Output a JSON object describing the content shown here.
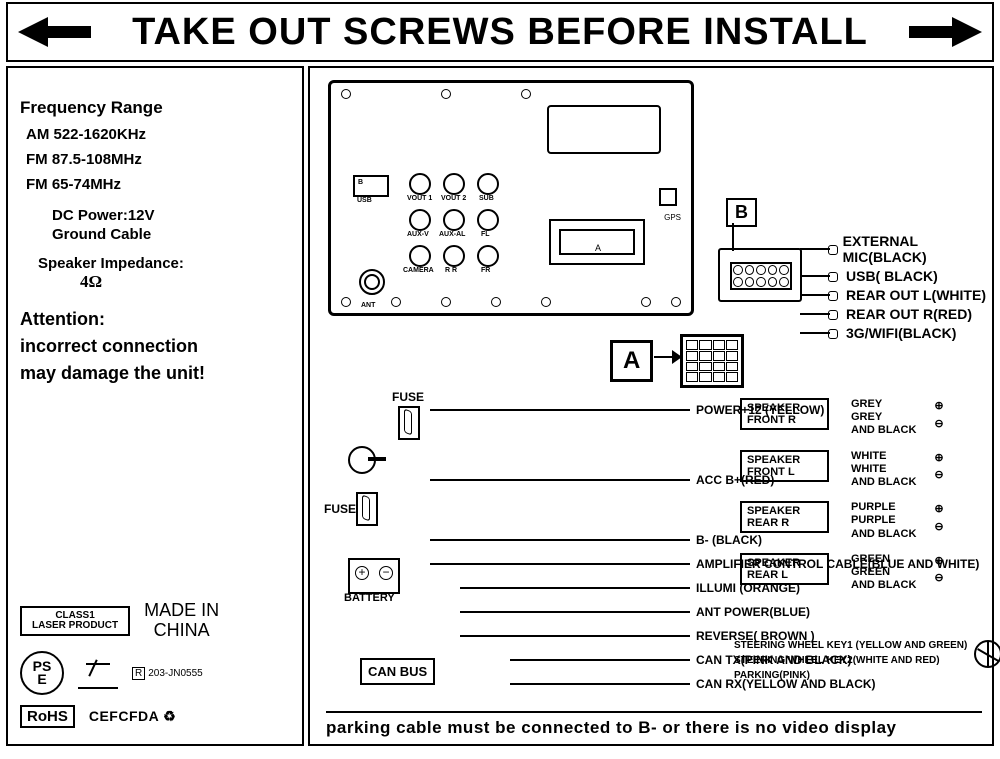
{
  "header": "TAKE OUT SCREWS BEFORE INSTALL",
  "left": {
    "freq_title": "Frequency Range",
    "am": "AM 522-1620KHz",
    "fm1": "FM 87.5-108MHz",
    "fm2": "FM 65-74MHz",
    "dc": "DC Power:12V",
    "ground": "Ground Cable",
    "speaker_imp": "Speaker Impedance:",
    "ohm": "4Ω",
    "attention": "Attention:\nincorrect connection\nmay damage the unit!",
    "class1_l1": "CLASS1",
    "class1_l2": "LASER PRODUCT",
    "madein_l1": "MADE IN",
    "madein_l2": "CHINA",
    "pse": "PS\nE",
    "reg": "203-JN0555",
    "rohs": "RoHS",
    "certs": "CEFCFDA ♻"
  },
  "chassis": {
    "usb": "USB",
    "b": "B",
    "vout1": "VOUT 1",
    "vout2": "VOUT 2",
    "sub": "SUB",
    "auxv": "AUX-V",
    "auxal": "AUX-AL",
    "fl": "FL",
    "camera": "CAMERA",
    "rr": "R R",
    "fr": "FR",
    "ant": "ANT",
    "gps": "GPS",
    "a": "A"
  },
  "b_label": "B",
  "b_wires": {
    "ext_mic": "EXTERNAL MIC(BLACK)",
    "usb": "USB( BLACK)",
    "rear_l": "REAR OUT L(WHITE)",
    "rear_r": "REAR OUT R(RED)",
    "wifi": "3G/WIFI(BLACK)"
  },
  "a_label": "A",
  "fuse": "FUSE",
  "battery": "BATTERY",
  "canbus": "CAN BUS",
  "wires": {
    "power12": "POWER+12 (YELLOW)",
    "acc": "ACC B+(RED)",
    "bminus": "B- (BLACK)",
    "amp": "AMPLIFIER CONTROL CABLE(BLUE AND WHITE)",
    "illumi": "ILLUMI (ORANGE)",
    "antpower": "ANT POWER(BLUE)",
    "reverse": "REVERSE( BROWN )",
    "cantx": "CAN TX(PINK AND BLACK)",
    "canrx": "CAN RX(YELLOW AND BLACK)"
  },
  "speakers": [
    {
      "label": "SPEAKER\nFRONT   R",
      "c1": "GREY",
      "c2": "GREY\nAND BLACK"
    },
    {
      "label": "SPEAKER\nFRONT   L",
      "c1": "WHITE",
      "c2": "WHITE\nAND BLACK"
    },
    {
      "label": "SPEAKER\nREAR    R",
      "c1": "PURPLE",
      "c2": "PURPLE\nAND BLACK"
    },
    {
      "label": "SPEAKER\nREAR    L",
      "c1": "GREEN",
      "c2": "GREEN\nAND BLACK"
    }
  ],
  "sw": {
    "k1": "STEERING WHEEL KEY1 (YELLOW AND GREEN)",
    "k2": "STEERING  WHEEL KEY2(WHITE AND RED)",
    "park": "PARKING(PINK)"
  },
  "bottom_note": "parking cable must be connected to B- or there is no video display"
}
